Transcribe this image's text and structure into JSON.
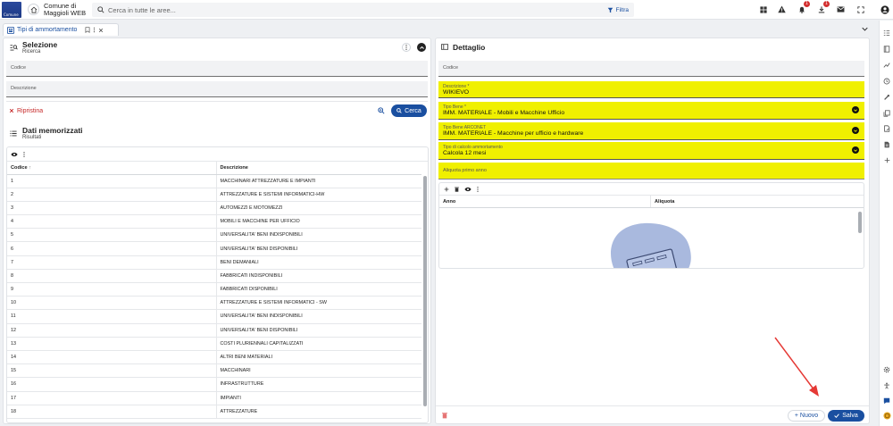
{
  "app": {
    "logo_text": "Comune",
    "name_line1": "Comune di",
    "name_line2": "Maggioli WEB"
  },
  "search": {
    "placeholder": "Cerca in tutte le aree...",
    "filter_label": "Filtra"
  },
  "topbar": {
    "notifications_badge": "1",
    "downloads_badge": "1"
  },
  "tab": {
    "label": "Tipi di ammortamento"
  },
  "selezione": {
    "title": "Selezione",
    "subtitle": "Ricerca",
    "codice_label": "Codice",
    "descrizione_label": "Descrizione",
    "reset_label": "Ripristina",
    "search_label": "Cerca"
  },
  "dati": {
    "title": "Dati memorizzati",
    "subtitle": "Risultati",
    "columns": [
      "Codice",
      "Descrizione"
    ],
    "rows": [
      [
        "1",
        "MACCHINARI ATTREZZATURE E IMPIANTI"
      ],
      [
        "2",
        "ATTREZZATURE E SISTEMI INFORMATICI-HW"
      ],
      [
        "3",
        "AUTOMEZZI E MOTOMEZZI"
      ],
      [
        "4",
        "MOBILI E MACCHINE PER UFFICIO"
      ],
      [
        "5",
        "UNIVERSALITA' BENI INDISPONIBILI"
      ],
      [
        "6",
        "UNIVERSALITA' BENI DISPONIBILI"
      ],
      [
        "7",
        "BENI DEMANIALI"
      ],
      [
        "8",
        "FABBRICATI INDISPONIBILI"
      ],
      [
        "9",
        "FABBRICATI DISPONIBILI"
      ],
      [
        "10",
        "ATTREZZATURE E SISTEMI INFORMATICI - SW"
      ],
      [
        "11",
        "UNIVERSALITA' BENI INDISPONIBILI"
      ],
      [
        "12",
        "UNIVERSALITA' BENI DISPONIBILI"
      ],
      [
        "13",
        "COSTI PLURIENNALI CAPITALIZZATI"
      ],
      [
        "14",
        "ALTRI BENI MATERIALI"
      ],
      [
        "15",
        "MACCHINARI"
      ],
      [
        "16",
        "INFRASTRUTTURE"
      ],
      [
        "17",
        "IMPIANTI"
      ],
      [
        "18",
        "ATTREZZATURE"
      ]
    ]
  },
  "dettaglio": {
    "title": "Dettaglio",
    "codice_label": "Codice",
    "descrizione": {
      "label": "Descrizione *",
      "value": "WIKIEVO"
    },
    "tipo_bene": {
      "label": "Tipo Bene *",
      "value": "IMM. MATERIALE - Mobili e Macchine Ufficio"
    },
    "tipo_bene_arconet": {
      "label": "Tipo Bene ARCONET",
      "value": "IMM. MATERIALE - Macchine per ufficio e hardware"
    },
    "tipo_calcolo": {
      "label": "Tipo di calcolo ammortamento",
      "value": "Calcola 12 mesi"
    },
    "aliquota_primo_anno_label": "Aliquota primo anno",
    "subtable_columns": [
      "Anno",
      "Aliquota"
    ],
    "nuovo_label": "Nuovo",
    "salva_label": "Salva"
  },
  "colors": {
    "accent": "#1a4fa0",
    "highlight": "#f0f000",
    "danger": "#d32f2f",
    "annotation_arrow": "#e53935"
  },
  "icons": [
    "app-logo",
    "home-icon",
    "search-icon",
    "filter-icon",
    "grid-icon",
    "warning-icon",
    "bell-icon",
    "download-icon",
    "mail-icon",
    "fullscreen-icon",
    "user-icon"
  ]
}
